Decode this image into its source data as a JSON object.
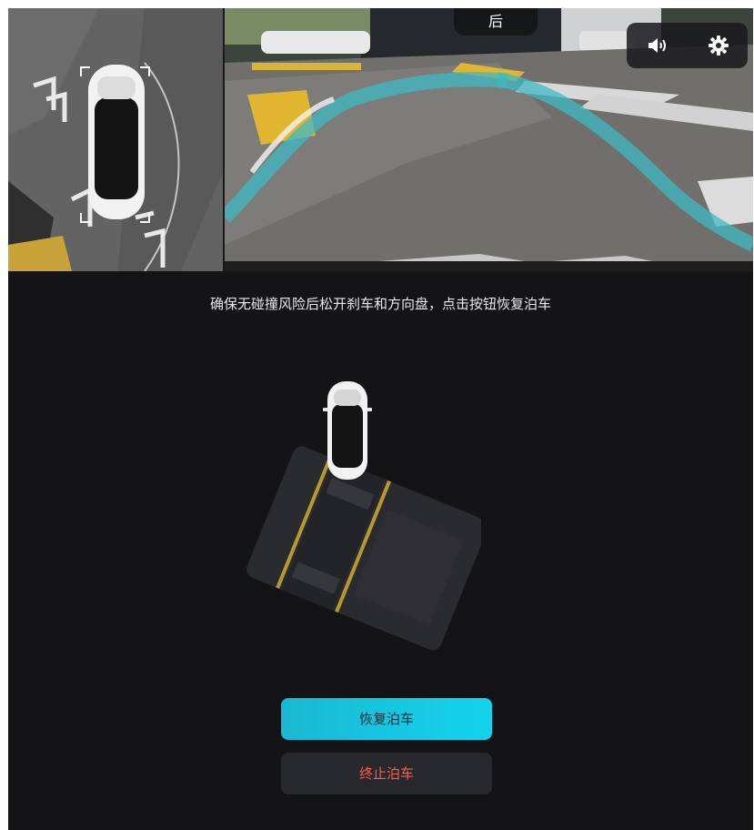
{
  "camera": {
    "view_label": "后"
  },
  "controls": {
    "sound_icon": "speaker-icon",
    "settings_icon": "gear-icon"
  },
  "instruction": "确保无碰撞风险后松开刹车和方向盘，点击按钮恢复泊车",
  "actions": {
    "resume_label": "恢复泊车",
    "stop_label": "终止泊车"
  },
  "colors": {
    "accent": "#14d3ee",
    "danger": "#ff5a4d",
    "background": "#141416"
  }
}
